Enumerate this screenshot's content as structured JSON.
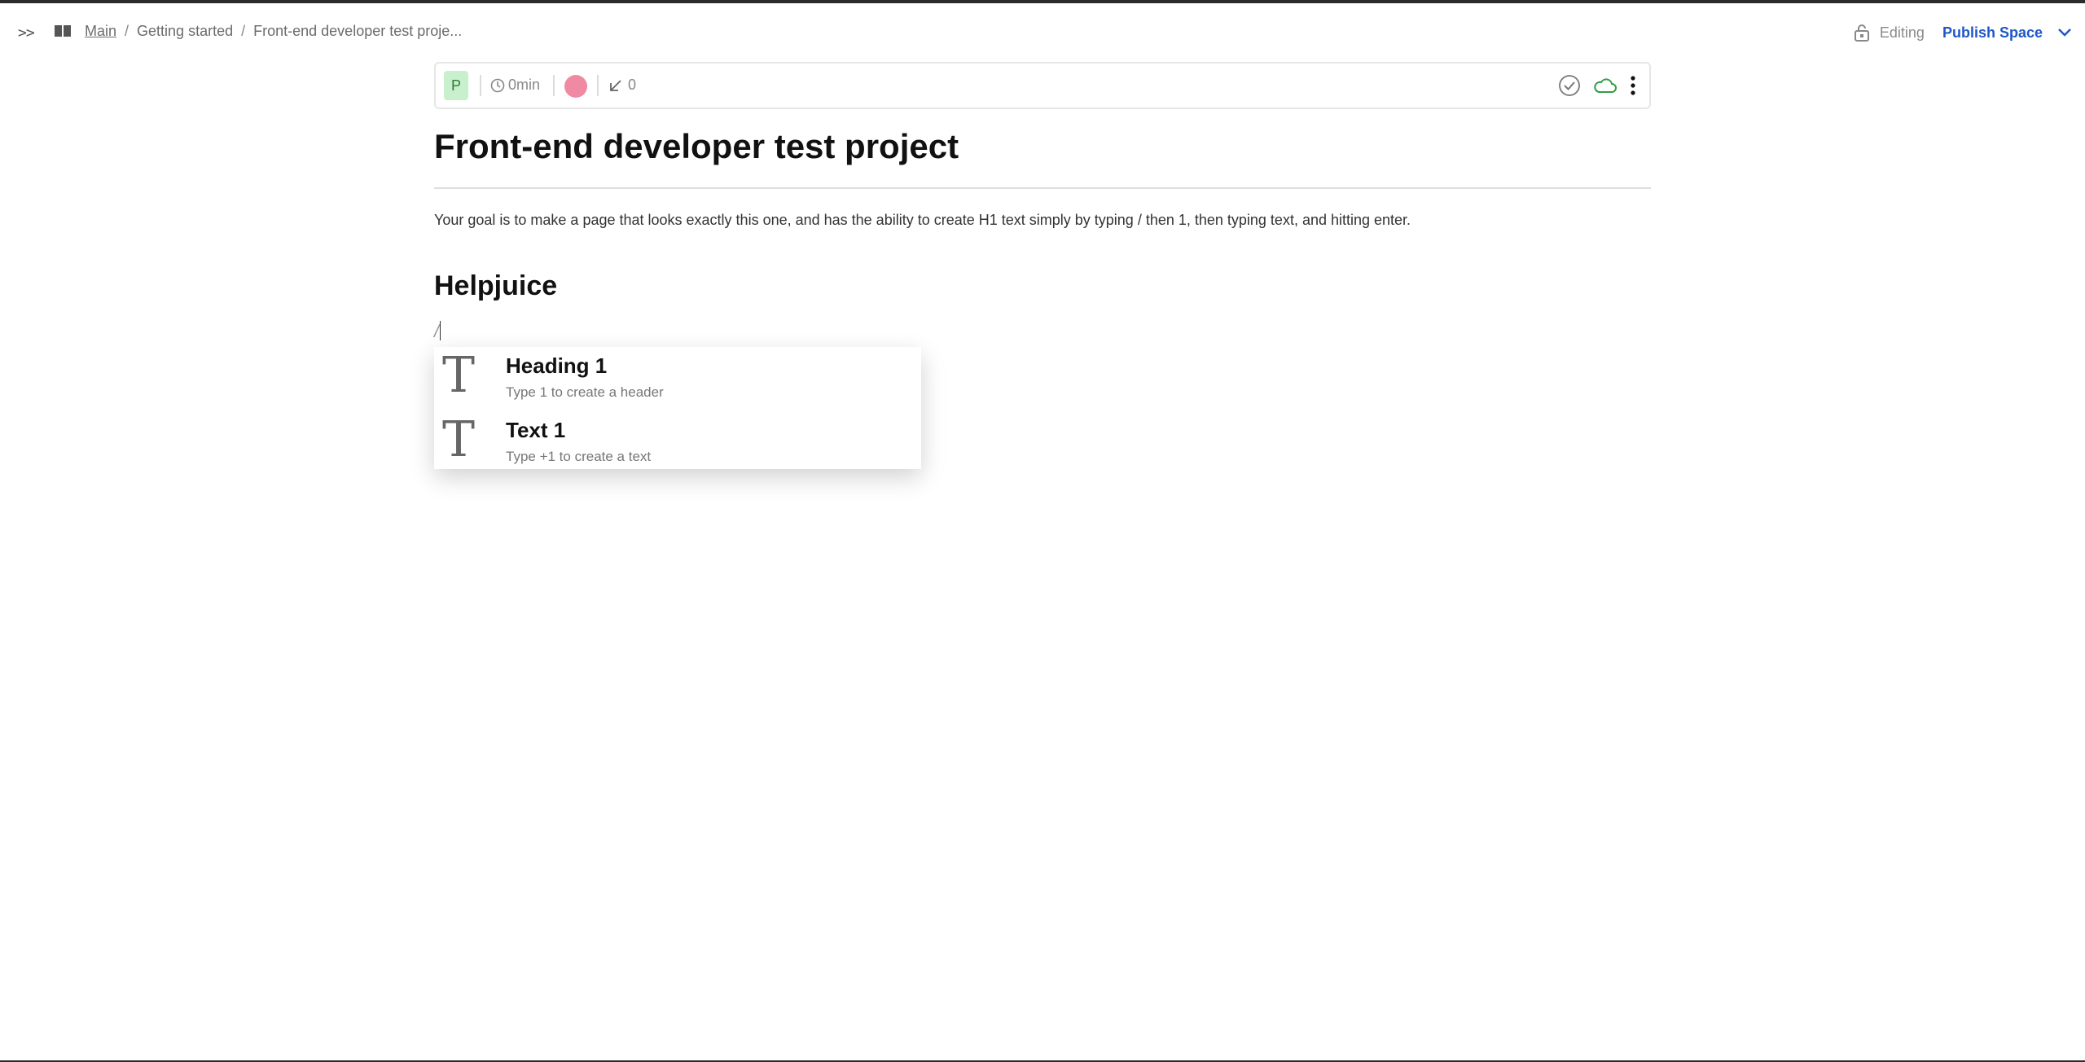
{
  "header": {
    "expand_label": ">>",
    "breadcrumb": {
      "items": [
        "Main",
        "Getting started",
        "Front-end developer test proje..."
      ],
      "separator": "/"
    },
    "editing_label": "Editing",
    "publish_label": "Publish Space"
  },
  "toolbar": {
    "author_initial": "P",
    "reading_time": "0min",
    "backlinks_count": "0"
  },
  "document": {
    "title": "Front-end developer test project",
    "instructions": "Your goal is to make a page that looks exactly this one, and has the ability to create H1 text simply by typing / then 1, then typing text, and hitting enter.",
    "heading_block": "Helpjuice",
    "command_input": "/"
  },
  "slash_menu": {
    "items": [
      {
        "icon": "T",
        "title": "Heading 1",
        "description": "Type 1 to create a header"
      },
      {
        "icon": "T",
        "title": "Text 1",
        "description": "Type +1 to create a text"
      }
    ]
  },
  "colors": {
    "accent": "#1e57c9",
    "cloud_ok": "#2e9e45",
    "avatar_bg": "#c8f0cc"
  }
}
